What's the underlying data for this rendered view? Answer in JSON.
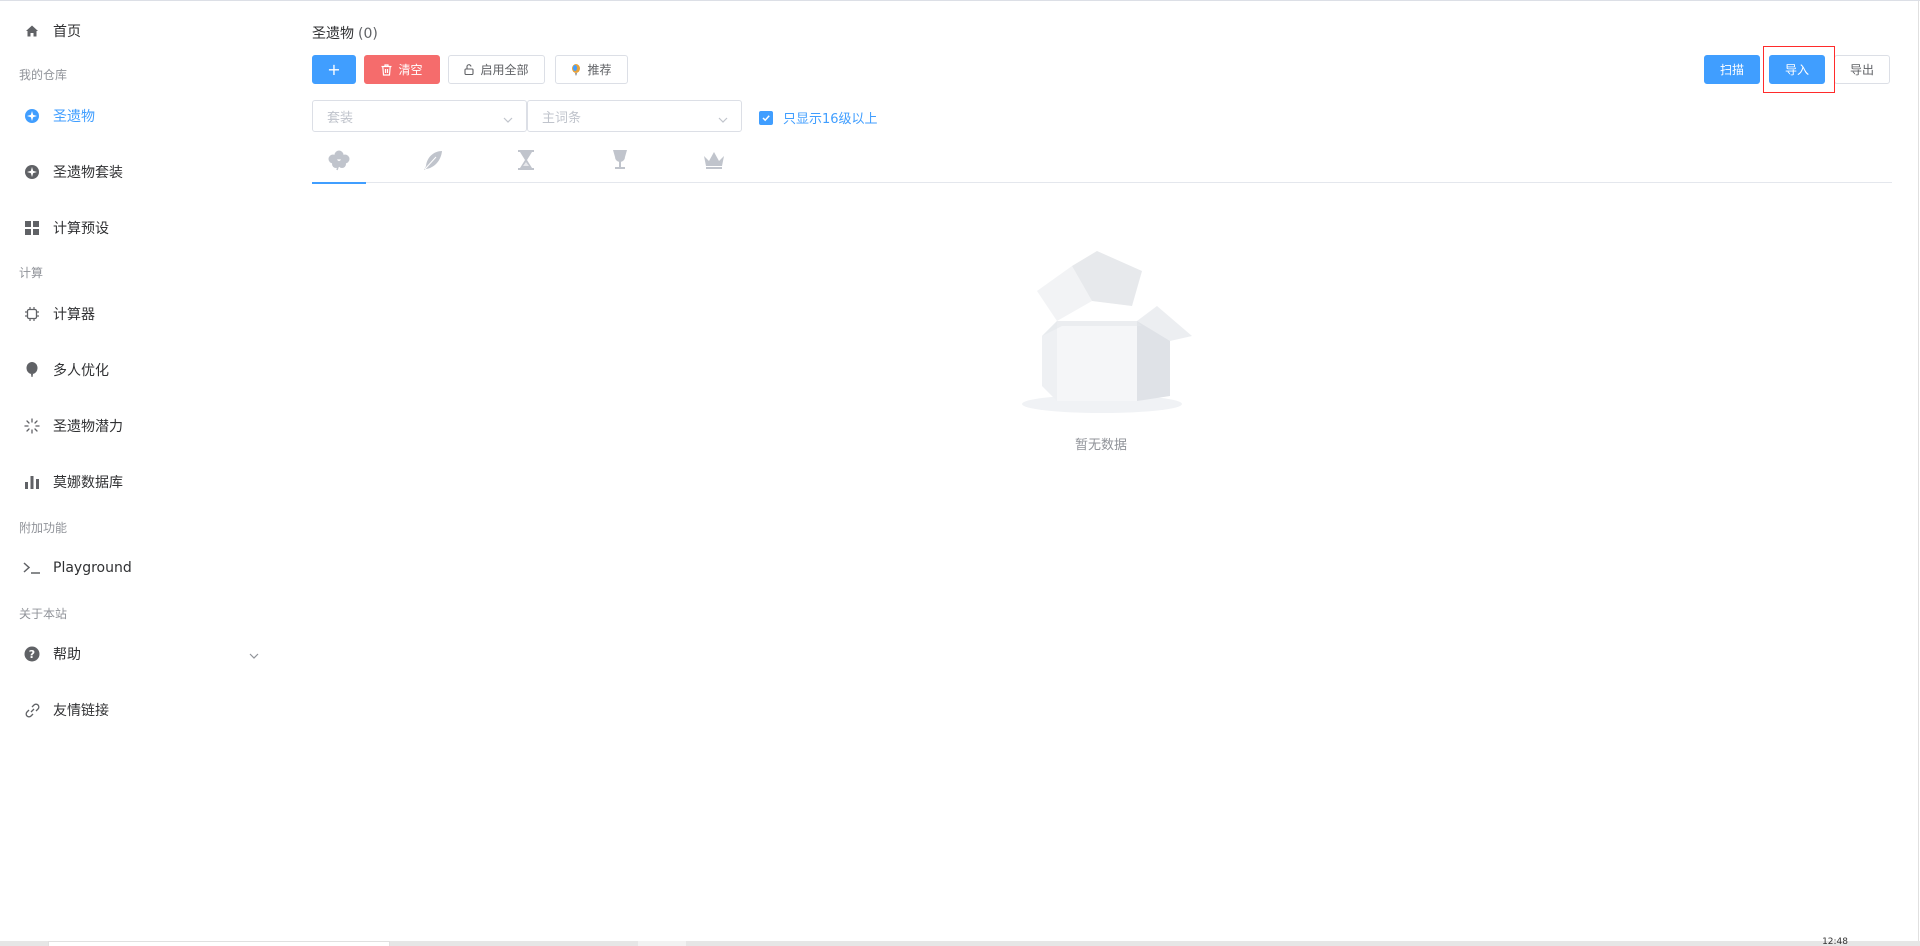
{
  "sidebar": {
    "home": "首页",
    "group_warehouse": "我的仓库",
    "artifacts": "圣遗物",
    "artifact_sets": "圣遗物套装",
    "calc_presets": "计算预设",
    "group_compute": "计算",
    "calculator": "计算器",
    "multi_opt": "多人优化",
    "artifact_potential": "圣遗物潜力",
    "mona_db": "莫娜数据库",
    "group_extra": "附加功能",
    "playground": "Playground",
    "group_about": "关于本站",
    "help": "帮助",
    "links": "友情链接"
  },
  "main": {
    "title": "圣遗物",
    "count": "(0)",
    "toolbar": {
      "add": "+",
      "clear": "清空",
      "enable_all": "启用全部",
      "recommend": "推荐",
      "scan": "扫描",
      "import": "导入",
      "export": "导出"
    },
    "filters": {
      "set_placeholder": "套装",
      "main_stat_placeholder": "主词条",
      "only_16_label": "只显示16级以上"
    },
    "tabs": [
      "flower-icon",
      "feather-icon",
      "hourglass-icon",
      "goblet-icon",
      "crown-icon"
    ],
    "empty_text": "暂无数据"
  },
  "taskbar": {
    "clock": "12:48"
  },
  "colors": {
    "primary": "#409eff",
    "danger": "#f56c6c",
    "highlight": "#ff2b2b"
  }
}
